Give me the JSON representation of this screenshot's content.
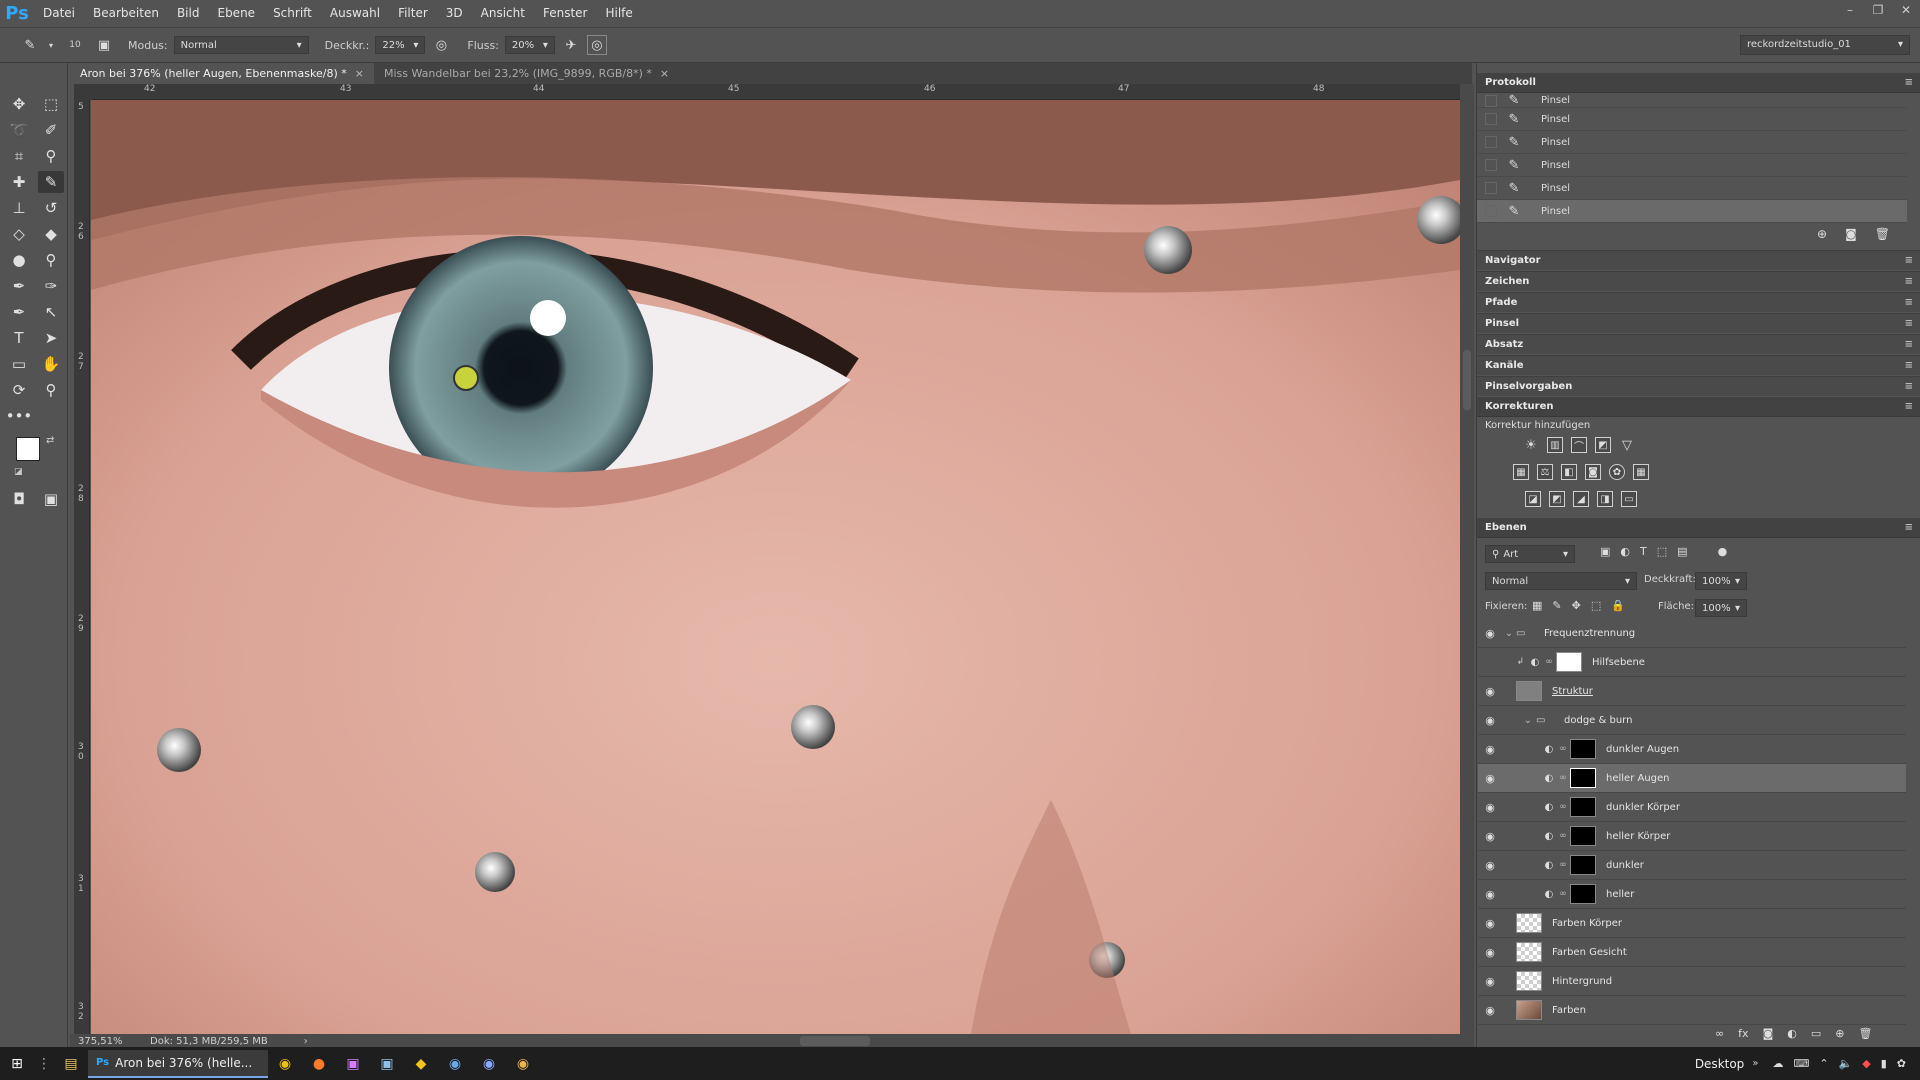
{
  "app": {
    "logo": "Ps"
  },
  "menu": [
    "Datei",
    "Bearbeiten",
    "Bild",
    "Ebene",
    "Schrift",
    "Auswahl",
    "Filter",
    "3D",
    "Ansicht",
    "Fenster",
    "Hilfe"
  ],
  "options": {
    "brush_size": "10",
    "mode_label": "Modus:",
    "mode_value": "Normal",
    "opacity_label": "Deckkr.:",
    "opacity_value": "22%",
    "flow_label": "Fluss:",
    "flow_value": "20%",
    "workspace": "reckordzeitstudio_01"
  },
  "tabs": [
    {
      "label": "Aron bei 376% (heller Augen, Ebenenmaske/8) *",
      "active": true
    },
    {
      "label": "Miss Wandelbar bei 23,2% (IMG_9899, RGB/8*) *",
      "active": false
    }
  ],
  "ruler": {
    "h": [
      "42",
      "43",
      "44",
      "45",
      "46",
      "47",
      "48"
    ],
    "v": [
      "5",
      "2 6",
      "2 7",
      "2 8",
      "2 9",
      "3 0",
      "3 1",
      "3 2"
    ]
  },
  "status": {
    "zoom": "375,51%",
    "doc": "Dok: 51,3 MB/259,5 MB"
  },
  "panels": {
    "protokoll": {
      "title": "Protokoll",
      "items": [
        "Pinsel",
        "Pinsel",
        "Pinsel",
        "Pinsel",
        "Pinsel",
        "Pinsel"
      ]
    },
    "collapsed": [
      "Navigator",
      "Zeichen",
      "Pfade",
      "Pinsel",
      "Absatz",
      "Kanäle",
      "Pinselvorgaben"
    ],
    "korrekturen": {
      "title": "Korrekturen",
      "subtitle": "Korrektur hinzufügen"
    },
    "ebenen": {
      "title": "Ebenen",
      "filter": "Art",
      "blend": "Normal",
      "opacity_label": "Deckkraft:",
      "opacity": "100%",
      "lock_label": "Fixieren:",
      "fill_label": "Fläche:",
      "fill": "100%",
      "layers": [
        {
          "name": "Frequenztrennung",
          "type": "group"
        },
        {
          "name": "Hilfsebene",
          "type": "adj",
          "thumb": "white"
        },
        {
          "name": "Struktur",
          "type": "pixel",
          "thumb": "gray"
        },
        {
          "name": "dodge & burn",
          "type": "group"
        },
        {
          "name": "dunkler Augen",
          "type": "adj",
          "thumb": "black"
        },
        {
          "name": "heller Augen",
          "type": "adj",
          "thumb": "black",
          "selected": true
        },
        {
          "name": "dunkler Körper",
          "type": "adj",
          "thumb": "black"
        },
        {
          "name": "heller Körper",
          "type": "adj",
          "thumb": "black"
        },
        {
          "name": "dunkler",
          "type": "adj",
          "thumb": "black"
        },
        {
          "name": "heller",
          "type": "adj",
          "thumb": "black"
        },
        {
          "name": "Farben Körper",
          "type": "pixel",
          "thumb": "checker"
        },
        {
          "name": "Farben Gesicht",
          "type": "pixel",
          "thumb": "checker"
        },
        {
          "name": "Hintergrund",
          "type": "pixel",
          "thumb": "checker"
        },
        {
          "name": "Farben",
          "type": "pixel",
          "thumb": "photo"
        }
      ]
    }
  },
  "taskbar": {
    "active_label": "Aron bei 376% (helle...",
    "desktop": "Desktop"
  },
  "colors": {
    "accent": "#31a8ff",
    "bg": "#535353",
    "panel_dark": "#424242"
  }
}
